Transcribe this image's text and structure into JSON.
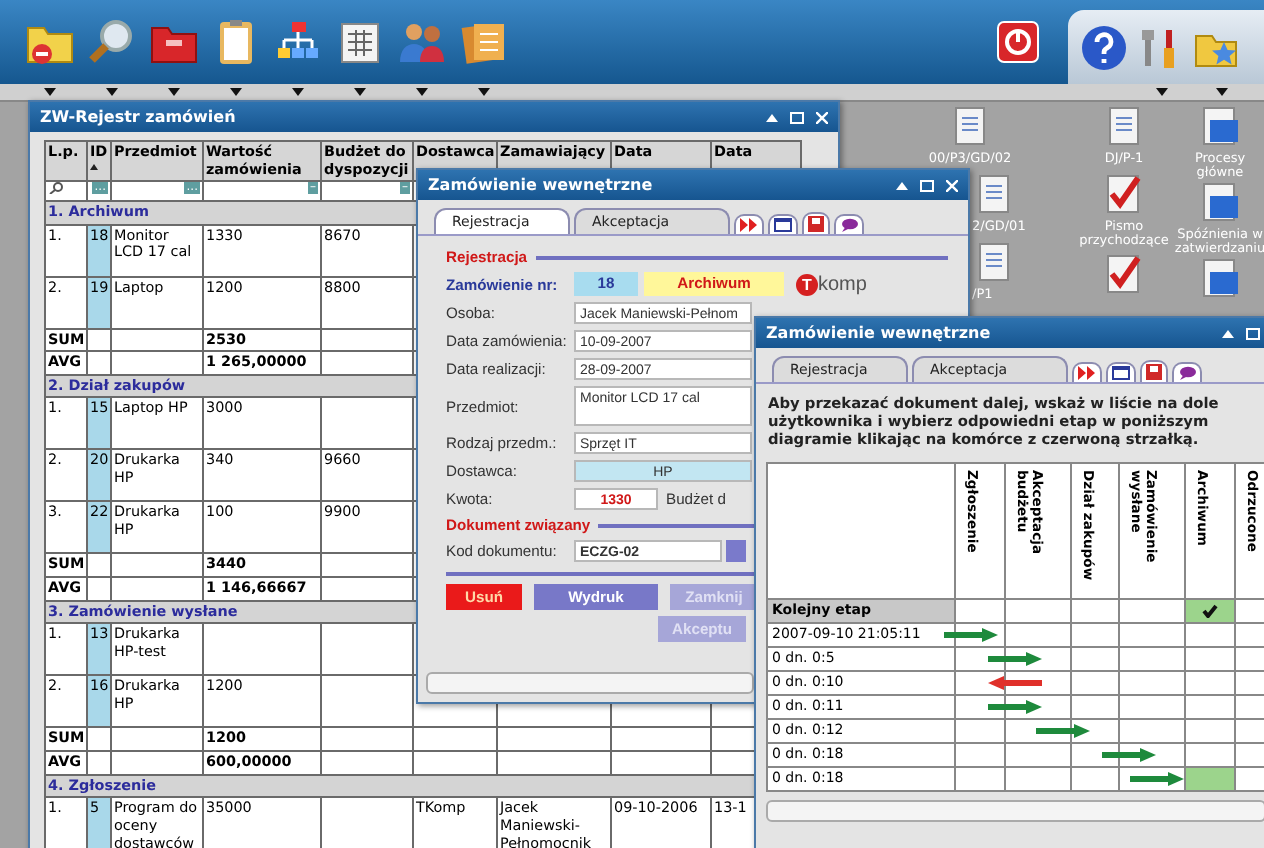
{
  "desktop_icons": [
    {
      "label": "00/P3/GD/02",
      "kind": "document"
    },
    {
      "label": "DJ/P-1",
      "kind": "document"
    },
    {
      "label": "Procesy główne",
      "kind": "blue-document"
    },
    {
      "label": "2/GD/01",
      "kind": "document"
    },
    {
      "label": "Pismo przychodzące",
      "kind": "checked-document"
    },
    {
      "label": "Spóźnienia w zatwierdzaniu",
      "kind": "blue-document"
    },
    {
      "label": "/P1",
      "kind": "document"
    },
    {
      "kind": "checked-document"
    },
    {
      "kind": "blue-document"
    }
  ],
  "register_window": {
    "title": "ZW-Rejestr zamówień",
    "columns": [
      {
        "label": "L.p.",
        "sorted": false
      },
      {
        "label": "ID",
        "sorted": true,
        "filter": "..."
      },
      {
        "label": "Przedmiot",
        "sorted": false,
        "filter": "..."
      },
      {
        "label": "Wartość zamówienia",
        "sorted": false,
        "filter": "–"
      },
      {
        "label": "Budżet do dyspozycji",
        "sorted": false,
        "filter": "–"
      },
      {
        "label": "Dostawca",
        "sorted": false
      },
      {
        "label": "Zamawiający",
        "sorted": false
      },
      {
        "label": "Data",
        "sorted": false
      },
      {
        "label": "Data",
        "sorted": false
      }
    ],
    "groups": [
      {
        "title": "1. Archiwum",
        "rows": [
          {
            "lp": "1.",
            "id": "18",
            "item": "Monitor LCD 17 cal",
            "value": "1330",
            "budget": "8670"
          },
          {
            "lp": "2.",
            "id": "19",
            "item": "Laptop",
            "value": "1200",
            "budget": "8800"
          }
        ],
        "totals": [
          {
            "label": "SUM",
            "value": "2530"
          },
          {
            "label": "AVG",
            "value": "1 265,00000"
          }
        ]
      },
      {
        "title": "2. Dział zakupów",
        "rows": [
          {
            "lp": "1.",
            "id": "15",
            "item": "Laptop HP",
            "value": "3000"
          },
          {
            "lp": "2.",
            "id": "20",
            "item": "Drukarka HP",
            "value": "340",
            "budget": "9660"
          },
          {
            "lp": "3.",
            "id": "22",
            "item": "Drukarka HP",
            "value": "100",
            "budget": "9900"
          }
        ],
        "totals": [
          {
            "label": "SUM",
            "value": "3440"
          },
          {
            "label": "AVG",
            "value": "1 146,66667"
          }
        ]
      },
      {
        "title": "3. Zamówienie wysłane",
        "rows": [
          {
            "lp": "1.",
            "id": "13",
            "item": "Drukarka HP-test"
          },
          {
            "lp": "2.",
            "id": "16",
            "item": "Drukarka HP",
            "value": "1200"
          }
        ],
        "totals": [
          {
            "label": "SUM",
            "value": "1200"
          },
          {
            "label": "AVG",
            "value": "600,00000"
          }
        ]
      },
      {
        "title": "4. Zgłoszenie",
        "rows": [
          {
            "lp": "1.",
            "id": "5",
            "item": "Program do oceny dostawców",
            "value": "35000",
            "supplier": "TKomp",
            "orderer": "Jacek Maniewski-Pełnomocnik",
            "date_1": "09-10-2006",
            "date_2": "13-1"
          }
        ]
      }
    ]
  },
  "order_window": {
    "title": "Zamówienie wewnętrzne",
    "tabs": [
      {
        "label": "Rejestracja",
        "selected": true
      },
      {
        "label": "Akceptacja",
        "selected": false
      }
    ],
    "section": "Rejestracja",
    "order_no_label": "Zamówienie nr:",
    "order_no": "18",
    "status": "Archiwum",
    "logo": {
      "mark": "T",
      "text": "komp"
    },
    "fields": [
      {
        "label": "Osoba:",
        "value": "Jacek Maniewski-Pełnom",
        "kind": "text"
      },
      {
        "label": "Data zamówienia:",
        "value": "10-09-2007",
        "kind": "text"
      },
      {
        "label": "Data realizacji:",
        "value": "28-09-2007",
        "kind": "text"
      },
      {
        "label": "Przedmiot:",
        "value": "Monitor LCD 17 cal",
        "kind": "multiline"
      },
      {
        "label": "Rodzaj przedm.:",
        "value": "Sprzęt IT",
        "kind": "text"
      },
      {
        "label": "Dostawca:",
        "value": "HP",
        "kind": "readonly"
      },
      {
        "label": "Kwota:",
        "value": "1330",
        "kind": "amount",
        "suffix": "Budżet d"
      }
    ],
    "related_section": "Dokument związany",
    "doc_code_label": "Kod dokumentu:",
    "doc_code": "ECZG-02",
    "buttons": [
      {
        "label": "Usuń",
        "kind": "danger"
      },
      {
        "label": "Wydruk",
        "kind": "normal"
      },
      {
        "label": "Zamknij",
        "kind": "disabled"
      },
      {
        "label": "Akceptu",
        "kind": "disabled"
      }
    ]
  },
  "workflow_window": {
    "title": "Zamówienie wewnętrzne",
    "tabs": [
      {
        "label": "Rejestracja",
        "selected": false
      },
      {
        "label": "Akceptacja",
        "selected": false
      }
    ],
    "instruction": "Aby przekazać dokument dalej, wskaż w liście na dole użytkownika i wybierz odpowiedni etap w poniższym diagramie klikając na komórce z czerwoną strzałką.",
    "stages": [
      "Zgłoszenie",
      "Akceptacja budżetu",
      "Dział zakupów",
      "Zamówienie wysłane",
      "Archiwum",
      "Odrzucone"
    ],
    "next_stage": {
      "label": "Kolejny etap",
      "cells": [
        {
          "kind": "none"
        },
        {
          "kind": "none"
        },
        {
          "kind": "none"
        },
        {
          "kind": "none"
        },
        {
          "kind": "check"
        },
        {
          "kind": "none"
        }
      ]
    },
    "history": [
      {
        "time": "2007-09-10 21:05:11",
        "cells": [
          {
            "kind": "arrow-in"
          },
          {
            "kind": "none"
          },
          {
            "kind": "none"
          },
          {
            "kind": "none"
          },
          {
            "kind": "none"
          },
          {
            "kind": "none"
          }
        ]
      },
      {
        "time": "0 dn. 0:5",
        "cells": [
          {
            "kind": "arrow-right"
          },
          {
            "kind": "none"
          },
          {
            "kind": "none"
          },
          {
            "kind": "none"
          },
          {
            "kind": "none"
          },
          {
            "kind": "none"
          }
        ]
      },
      {
        "time": "0 dn. 0:10",
        "cells": [
          {
            "kind": "arrow-left"
          },
          {
            "kind": "none"
          },
          {
            "kind": "none"
          },
          {
            "kind": "none"
          },
          {
            "kind": "none"
          },
          {
            "kind": "none"
          }
        ]
      },
      {
        "time": "0 dn. 0:11",
        "cells": [
          {
            "kind": "arrow-right"
          },
          {
            "kind": "none"
          },
          {
            "kind": "none"
          },
          {
            "kind": "none"
          },
          {
            "kind": "none"
          },
          {
            "kind": "none"
          }
        ]
      },
      {
        "time": "0 dn. 0:12",
        "cells": [
          {
            "kind": "none"
          },
          {
            "kind": "arrow-right"
          },
          {
            "kind": "none"
          },
          {
            "kind": "none"
          },
          {
            "kind": "none"
          },
          {
            "kind": "none"
          }
        ]
      },
      {
        "time": "0 dn. 0:18",
        "cells": [
          {
            "kind": "none"
          },
          {
            "kind": "none"
          },
          {
            "kind": "arrow-right"
          },
          {
            "kind": "none"
          },
          {
            "kind": "none"
          },
          {
            "kind": "none"
          }
        ]
      },
      {
        "time": "0 dn. 0:18",
        "cells": [
          {
            "kind": "none"
          },
          {
            "kind": "none"
          },
          {
            "kind": "none"
          },
          {
            "kind": "arrow-right"
          },
          {
            "kind": "reached"
          },
          {
            "kind": "none"
          }
        ]
      }
    ]
  }
}
